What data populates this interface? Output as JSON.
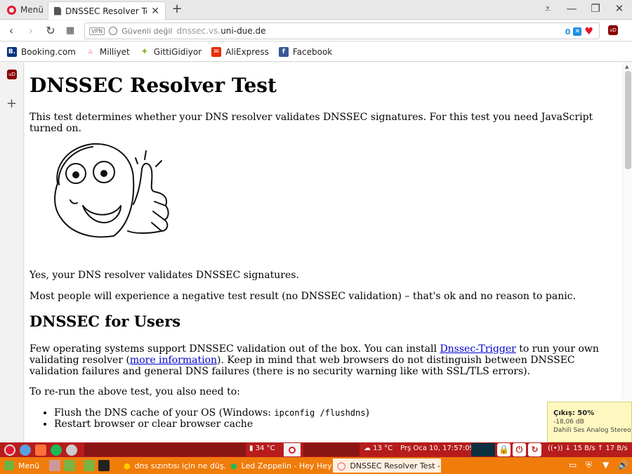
{
  "tabbar": {
    "menu_label": "Menü",
    "tab_title": "DNSSEC Resolver Test",
    "tab_close": "✕",
    "new_tab": "+",
    "window_controls": [
      "⩡",
      "—",
      "❐",
      "✕"
    ]
  },
  "addressbar": {
    "vpn_label": "VPN",
    "security_label": "Güvenli değil",
    "url_prefix": "dnssec.vs.",
    "url_domain": "uni-due.de",
    "block_count": "0",
    "ublock_label": "uD"
  },
  "bookmarks": [
    {
      "label": "Booking.com",
      "icon": "B.",
      "color": "#003580"
    },
    {
      "label": "Milliyet",
      "icon": "♨",
      "color": "#e3162d"
    },
    {
      "label": "GittiGidiyor",
      "icon": "✚",
      "color": "#7db51d"
    },
    {
      "label": "AliExpress",
      "icon": "✉",
      "color": "#e62e04"
    },
    {
      "label": "Facebook",
      "icon": "f",
      "color": "#3b5998"
    }
  ],
  "page": {
    "title": "DNSSEC Resolver Test",
    "intro": "This test determines whether your DNS resolver validates DNSSEC signatures. For this test you need JavaScript turned on.",
    "result": "Yes, your DNS resolver validates DNSSEC signatures.",
    "note": "Most people will experience a negative test result (no DNSSEC validation) – that's ok and no reason to panic.",
    "users_heading": "DNSSEC for Users",
    "users_p1_a": "Few operating systems support DNSSEC validation out of the box. You can install ",
    "users_p1_link1": "Dnssec-Trigger",
    "users_p1_b": " to run your own validating resolver (",
    "users_p1_link2": "more information",
    "users_p1_c": "). Keep in mind that web browsers do not distinguish between DNSSEC validation failures and general DNS failures (there is no security warning like with SSL/TLS errors).",
    "rerun": "To re-run the above test, you also need to:",
    "list_item1_a": "Flush the DNS cache of your OS (Windows: ",
    "list_item1_code": "ipconfig /flushdns",
    "list_item1_b": ")",
    "list_item2": "Restart browser or clear browser cache"
  },
  "tooltip": {
    "title": "Çıkış: 50%",
    "db": "-18,06 dB",
    "device": "Dahili Ses Analog Stereo"
  },
  "panel_top": {
    "cpu_temp": "34 °C",
    "weather": "13 °C",
    "datetime": "Prş Oca 10, 17:57:09",
    "net_down": "15 B/s",
    "net_up": "17 B/s"
  },
  "panel_bottom": {
    "menu_label": "Menü",
    "task1": "dns sızıntısı için ne düş...",
    "task2": "Led Zeppelin - Hey Hey ...",
    "task3": "DNSSEC Resolver Test -..."
  }
}
